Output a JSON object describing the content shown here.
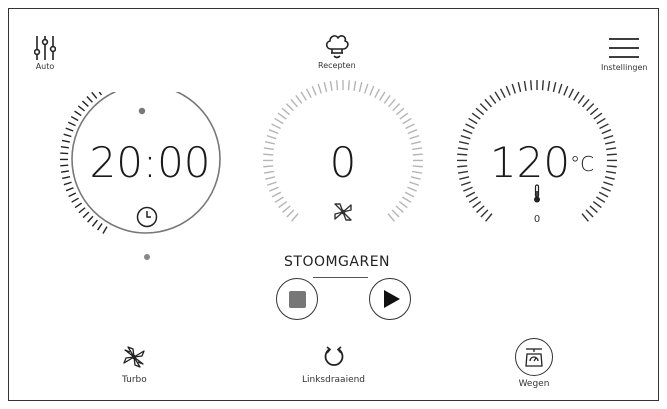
{
  "header": {
    "auto_label": "Auto",
    "recipes_label": "Recepten",
    "settings_label": "Instellingen"
  },
  "timer": {
    "time": "20:00"
  },
  "speed": {
    "value": "0"
  },
  "temperature": {
    "value": "120",
    "unit": "°C",
    "measured": "0"
  },
  "mode": {
    "label": "STOOMGAREN"
  },
  "bottom": {
    "turbo_label": "Turbo",
    "reverse_label": "Linksdraaiend",
    "weigh_label": "Wegen"
  },
  "icons": {
    "auto": "sliders-icon",
    "recipes": "chef-hat-icon",
    "settings": "menu-icon",
    "timer": "clock-icon",
    "speed": "blade-icon",
    "temperature": "thermometer-icon",
    "stop": "stop-icon",
    "play": "play-icon",
    "turbo": "turbo-icon",
    "reverse": "reverse-rotation-icon",
    "weigh": "scale-icon"
  }
}
